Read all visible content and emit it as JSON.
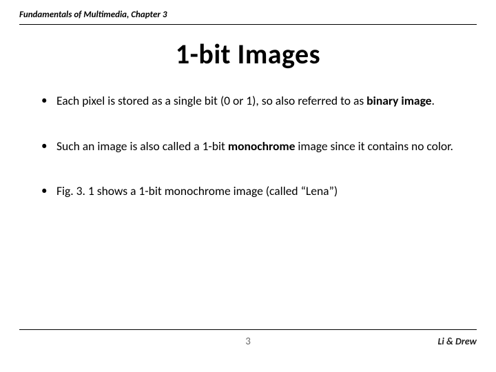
{
  "header": {
    "chapter_line": "Fundamentals of Multimedia, Chapter 3"
  },
  "title": "1-bit Images",
  "bullets": [
    {
      "pre": "Each pixel is stored as a single bit (0 or 1), so also referred to as ",
      "bold": "binary image",
      "post": "."
    },
    {
      "pre": "Such an image is also called a 1-bit ",
      "bold": "monochrome",
      "post": " image since it contains no color."
    },
    {
      "pre": "Fig. 3. 1 shows a 1-bit monochrome image (called “Lena”)",
      "bold": "",
      "post": ""
    }
  ],
  "footer": {
    "page": "3",
    "authors": "Li & Drew"
  }
}
